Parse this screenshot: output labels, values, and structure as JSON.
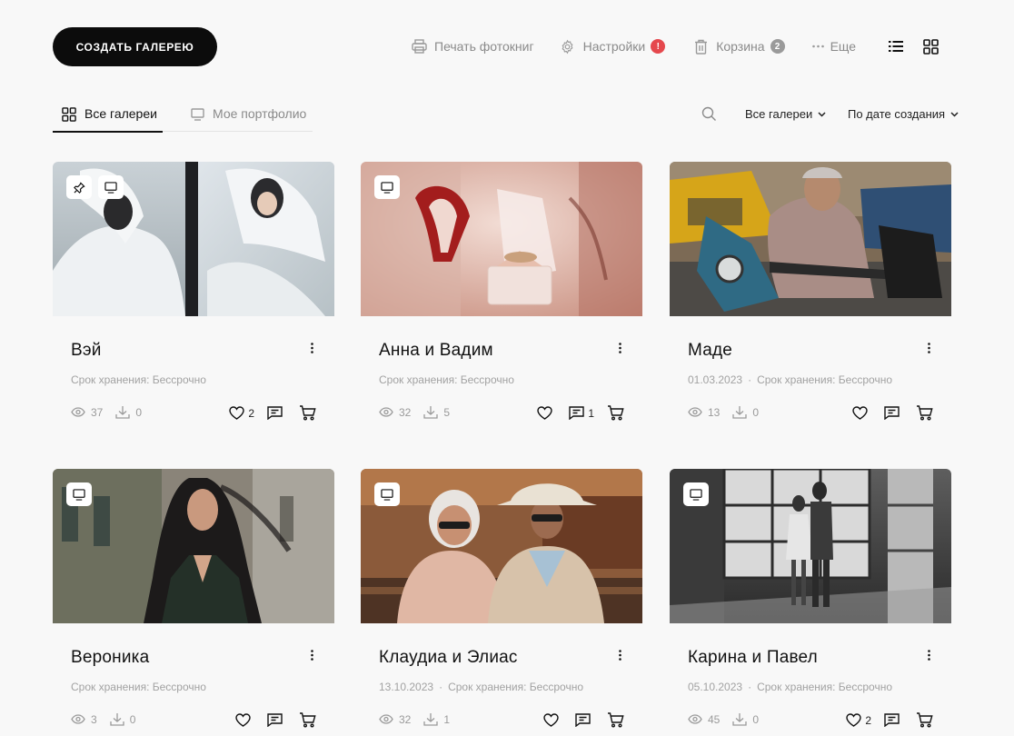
{
  "header": {
    "create_button": "СОЗДАТЬ ГАЛЕРЕЮ",
    "nav": {
      "print": "Печать фотокниг",
      "settings": "Настройки",
      "settings_badge": "!",
      "trash": "Корзина",
      "trash_badge": "2",
      "more": "Еще"
    }
  },
  "tabs": {
    "all": "Все галереи",
    "portfolio": "Мое портфолио"
  },
  "filters": {
    "galleries": "Все галереи",
    "sort": "По дате создания"
  },
  "colors": {
    "accent": "#0c0c0c",
    "alert_badge": "#e5484d",
    "count_badge": "#9a9a9a"
  },
  "cards": [
    {
      "title": "Вэй",
      "meta": "Срок хранения: Бессрочно",
      "date": "",
      "views": "37",
      "downloads": "0",
      "likes": "2",
      "comments": "",
      "icons": [
        "pin-icon",
        "monitor-icon"
      ]
    },
    {
      "title": "Анна и Вадим",
      "meta": "Срок хранения: Бессрочно",
      "date": "",
      "views": "32",
      "downloads": "5",
      "likes": "",
      "comments": "1",
      "icons": [
        "monitor-icon"
      ]
    },
    {
      "title": "Маде",
      "meta": "Срок хранения: Бессрочно",
      "date": "01.03.2023",
      "views": "13",
      "downloads": "0",
      "likes": "",
      "comments": "",
      "icons": []
    },
    {
      "title": "Вероника",
      "meta": "Срок хранения: Бессрочно",
      "date": "",
      "views": "3",
      "downloads": "0",
      "likes": "",
      "comments": "",
      "icons": [
        "monitor-icon"
      ]
    },
    {
      "title": "Клаудиа и Элиас",
      "meta": "Срок хранения: Бессрочно",
      "date": "13.10.2023",
      "views": "32",
      "downloads": "1",
      "likes": "",
      "comments": "",
      "icons": [
        "monitor-icon"
      ]
    },
    {
      "title": "Карина и Павел",
      "meta": "Срок хранения: Бессрочно",
      "date": "05.10.2023",
      "views": "45",
      "downloads": "0",
      "likes": "2",
      "comments": "",
      "icons": [
        "monitor-icon"
      ]
    }
  ]
}
